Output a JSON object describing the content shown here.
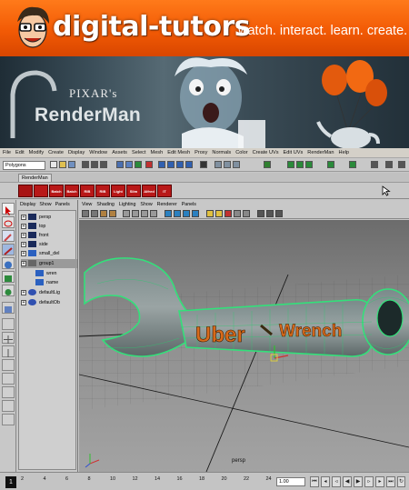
{
  "banner": {
    "brand": "digital-tutors",
    "tagline": "watch. interact. learn. create.",
    "colors": {
      "orange": "#f25a05",
      "text": "#ffffff"
    }
  },
  "hero": {
    "pixar": "PIXAR's",
    "renderman": "RenderMan"
  },
  "maya": {
    "menubar": [
      "File",
      "Edit",
      "Modify",
      "Create",
      "Display",
      "Window",
      "Assets",
      "Select",
      "Mesh",
      "Edit Mesh",
      "Proxy",
      "Normals",
      "Color",
      "Create UVs",
      "Edit UVs",
      "RenderMan",
      "Help"
    ],
    "mode": "Polygons",
    "shelf_tab": "RenderMan",
    "shelf_buttons": [
      "",
      "",
      "Batch",
      "Batch",
      "RIB Render",
      "RIB Render",
      "Light",
      "Slim",
      "Alfred",
      "IT"
    ],
    "outliner": {
      "menu": [
        "Display",
        "Show",
        "Panels"
      ],
      "items": [
        {
          "label": "persp",
          "icon": "camera-icon",
          "selected": false
        },
        {
          "label": "top",
          "icon": "camera-icon",
          "selected": false
        },
        {
          "label": "front",
          "icon": "camera-icon",
          "selected": false
        },
        {
          "label": "side",
          "icon": "camera-icon",
          "selected": false
        },
        {
          "label": "small_del",
          "icon": "mesh-icon",
          "selected": false
        },
        {
          "label": "group1",
          "icon": "group-icon",
          "selected": true
        },
        {
          "label": "wren",
          "icon": "mesh-icon",
          "selected": false
        },
        {
          "label": "name",
          "icon": "mesh-icon",
          "selected": false
        },
        {
          "label": "defaultLig",
          "icon": "set-icon",
          "selected": false
        },
        {
          "label": "defaultOb",
          "icon": "set-icon",
          "selected": false
        }
      ]
    },
    "panel_menu": [
      "View",
      "Shading",
      "Lighting",
      "Show",
      "Renderer",
      "Panels"
    ],
    "viewport": {
      "camera": "persp",
      "wrench_text_1": "Uber",
      "wrench_text_2": "Wrench"
    },
    "timeline": {
      "start_frame": "1",
      "ticks": [
        "2",
        "4",
        "6",
        "8",
        "10",
        "12",
        "14",
        "16",
        "18",
        "20",
        "22",
        "24"
      ],
      "current": "1.00"
    }
  }
}
